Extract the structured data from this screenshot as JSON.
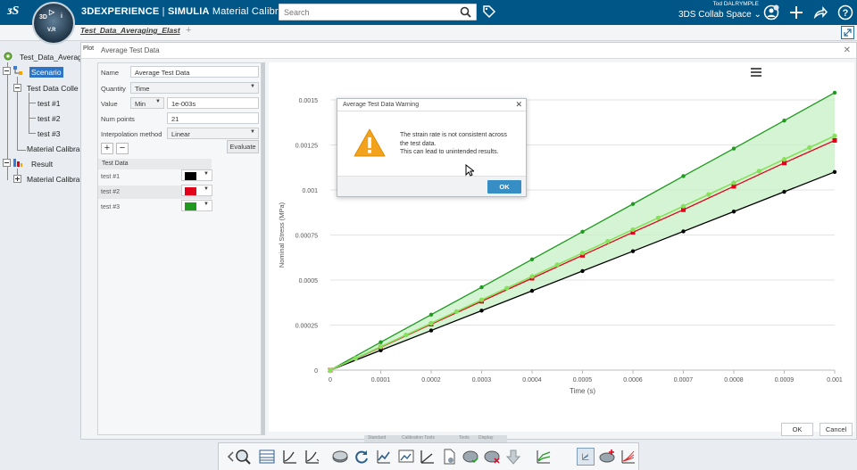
{
  "app": {
    "brand": "3DEXPERIENCE",
    "separator": "|",
    "product": "SIMULIA",
    "app_name": "Material Calibration",
    "compass_version": "V.R",
    "search_placeholder": "Search",
    "user": "Tod DALRYMPLE",
    "collab_space": "3DS Collab Space"
  },
  "tabs": {
    "active": "Test_Data_Averaging_Elast",
    "add_symbol": "+"
  },
  "tree": {
    "root": "Test_Data_Averag",
    "scenario": "Scenario",
    "collection": "Test Data Colle",
    "tests": [
      "test #1",
      "test #2",
      "test #3"
    ],
    "material_calib_1": "Material Calibra",
    "result": "Result",
    "material_calib_2": "Material Calibra"
  },
  "dialog": {
    "plot_tab": "Plot",
    "title": "Average Test Data",
    "name_label": "Name",
    "name_value": "Average Test Data",
    "quantity_label": "Quantity",
    "quantity_value": "Time",
    "value_label": "Value",
    "value_mode": "Min",
    "value_value": "1e-003s",
    "numpoints_label": "Num points",
    "numpoints_value": "21",
    "interp_label": "Interpolation method",
    "interp_value": "Linear",
    "add_symbol": "+",
    "remove_symbol": "−",
    "evaluate_label": "Evaluate",
    "testdata_header": "Test Data",
    "tests": [
      {
        "name": "test #1",
        "color": "#000000"
      },
      {
        "name": "test #2",
        "color": "#e3001b"
      },
      {
        "name": "test #3",
        "color": "#1f9a1f"
      }
    ],
    "ok_label": "OK",
    "cancel_label": "Cancel"
  },
  "warning": {
    "title": "Average Test Data Warning",
    "line1": "The strain rate is not consistent across",
    "line2": "the test data.",
    "line3": "This can lead to unintended results.",
    "ok_label": "OK"
  },
  "bottom_tabs": [
    "Standard",
    "Calibration Tools",
    "Tools",
    "Display"
  ],
  "colors": {
    "topbar": "#005686",
    "band_fill": "#c6f0c6",
    "accent_button": "#368ec4"
  },
  "chart_data": {
    "type": "line",
    "title": "",
    "xlabel": "Time (s)",
    "ylabel": "Nominal Stress (MPa)",
    "xlim": [
      0,
      0.001
    ],
    "ylim": [
      0,
      0.0015
    ],
    "xticks": [
      "0",
      "0.0001",
      "0.0002",
      "0.0003",
      "0.0004",
      "0.0005",
      "0.0006",
      "0.0007",
      "0.0008",
      "0.0009",
      "0.001"
    ],
    "yticks": [
      "0",
      "0.00025",
      "0.0005",
      "0.00075",
      "0.001",
      "0.00125",
      "0.0015"
    ],
    "grid": "horizontal",
    "legend": "none",
    "series": [
      {
        "color": "#1f9a1f",
        "marker": "circle",
        "x": [
          0,
          0.0001,
          0.0002,
          0.0003,
          0.0004,
          0.0005,
          0.0006,
          0.0007,
          0.0008,
          0.0009,
          0.001
        ],
        "y": [
          0,
          0.000155,
          0.000308,
          0.00046,
          0.000615,
          0.000768,
          0.000922,
          0.001077,
          0.00123,
          0.001385,
          0.00154
        ]
      },
      {
        "color": "#000000",
        "marker": "circle",
        "x": [
          0,
          0.0001,
          0.0002,
          0.0003,
          0.0004,
          0.0005,
          0.0006,
          0.0007,
          0.0008,
          0.0009,
          0.001
        ],
        "y": [
          0,
          0.00011,
          0.00022,
          0.00033,
          0.00044,
          0.00055,
          0.00066,
          0.00077,
          0.00088,
          0.00099,
          0.0011
        ]
      },
      {
        "color": "#e3001b",
        "marker": "square",
        "x": [
          0,
          0.0001,
          0.0002,
          0.0003,
          0.0004,
          0.0005,
          0.0006,
          0.0007,
          0.0008,
          0.0009,
          0.001
        ],
        "y": [
          0,
          0.000127,
          0.000255,
          0.000382,
          0.00051,
          0.000637,
          0.000765,
          0.00089,
          0.00102,
          0.00115,
          0.001275
        ]
      },
      {
        "color": "#86e05a",
        "marker": "circle",
        "x": [
          0,
          5e-05,
          0.0001,
          0.00015,
          0.0002,
          0.00025,
          0.0003,
          0.00035,
          0.0004,
          0.00045,
          0.0005,
          0.00055,
          0.0006,
          0.00065,
          0.0007,
          0.00075,
          0.0008,
          0.00085,
          0.0009,
          0.00095,
          0.001
        ],
        "y": [
          0,
          6.5e-05,
          0.00013,
          0.000195,
          0.00026,
          0.000325,
          0.00039,
          0.000455,
          0.00052,
          0.000585,
          0.00065,
          0.000715,
          0.00078,
          0.000845,
          0.00091,
          0.000975,
          0.00104,
          0.001105,
          0.00117,
          0.001235,
          0.0013
        ]
      }
    ]
  }
}
